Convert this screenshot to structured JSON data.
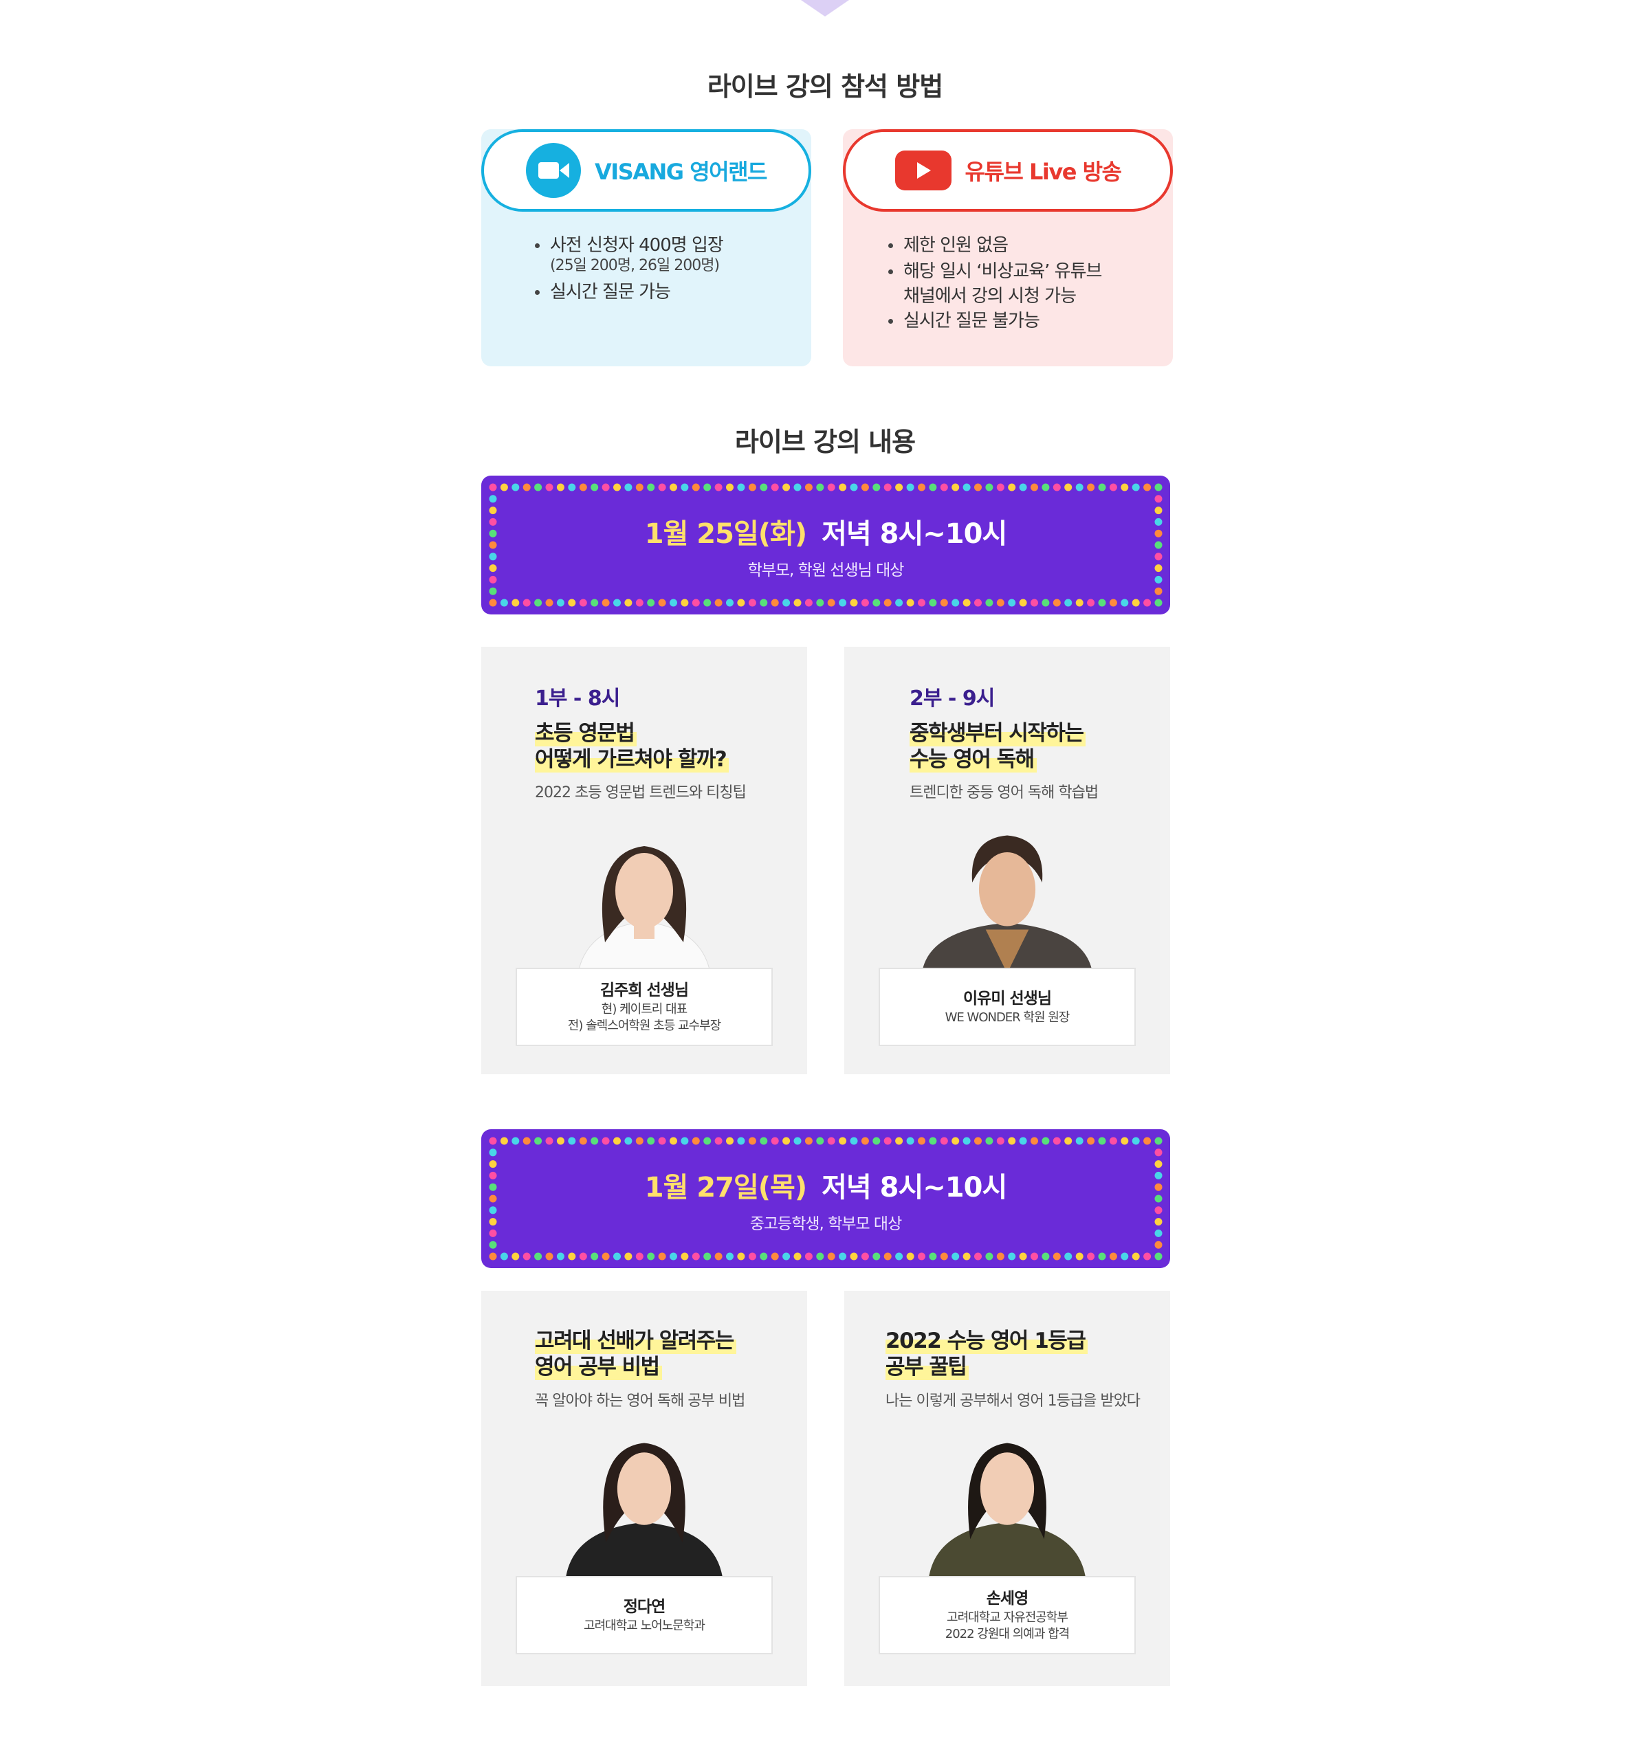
{
  "method_section": {
    "title": "라이브 강의 참석 방법",
    "visang": {
      "label": "VISANG 영어랜드",
      "icon": "zoom-video-icon",
      "accent": "#16b0e0",
      "bg": "#e1f4fb",
      "bullets": [
        {
          "text": "사전 신청자 400명 입장",
          "sub": "(25일 200명, 26일 200명)"
        },
        {
          "text": "실시간 질문 가능"
        }
      ]
    },
    "youtube": {
      "label": "유튜브 Live 방송",
      "icon": "youtube-play-icon",
      "accent": "#e8382e",
      "bg": "#fde6e6",
      "bullets": [
        {
          "text": "제한 인원 없음"
        },
        {
          "text": "해당 일시 ‘비상교육’ 유튜브",
          "cont": "채널에서 강의 시청 가능"
        },
        {
          "text": "실시간 질문 불가능"
        }
      ]
    }
  },
  "content_section": {
    "title": "라이브 강의 내용"
  },
  "day1": {
    "date": "1월 25일(화)",
    "time": "저녁 8시~10시",
    "audience": "학부모, 학원 선생님 대상",
    "lectures": [
      {
        "part": "1부 - 8시",
        "title_line1": "초등 영문법",
        "title_line2": "어떻게 가르쳐야 할까?",
        "desc": "2022 초등 영문법 트렌드와 티칭팁",
        "teacher": "김주희 선생님",
        "info": [
          "현) 케이트리 대표",
          "전) 솔렉스어학원 초등 교수부장"
        ]
      },
      {
        "part": "2부 - 9시",
        "title_line1": "중학생부터 시작하는",
        "title_line2": "수능 영어 독해",
        "desc": "트렌디한 중등 영어 독해 학습법",
        "teacher": "이유미 선생님",
        "info": [
          "WE WONDER 학원 원장"
        ]
      }
    ]
  },
  "day2": {
    "date": "1월 27일(목)",
    "time": "저녁 8시~10시",
    "audience": "중고등학생, 학부모 대상",
    "lectures": [
      {
        "title_line1": "고려대 선배가 알려주는",
        "title_line2": "영어 공부 비법",
        "desc": "꼭 알아야 하는 영어 독해 공부 비법",
        "teacher": "정다연",
        "info": [
          "고려대학교 노어노문학과"
        ]
      },
      {
        "title_line1": "2022 수능 영어 1등급",
        "title_line2": "공부 꿀팁",
        "desc": "나는 이렇게 공부해서 영어 1등급을 받았다",
        "teacher": "손세영",
        "info": [
          "고려대학교 자유전공학부",
          "2022 강원대 의예과 합격"
        ]
      }
    ]
  },
  "colors": {
    "banner_purple": "#6a2bd8",
    "date_yellow": "#ffe06b",
    "highlight": "#fff59a",
    "card_bg": "#f2f2f2",
    "arrow": "#dcd0f5"
  }
}
